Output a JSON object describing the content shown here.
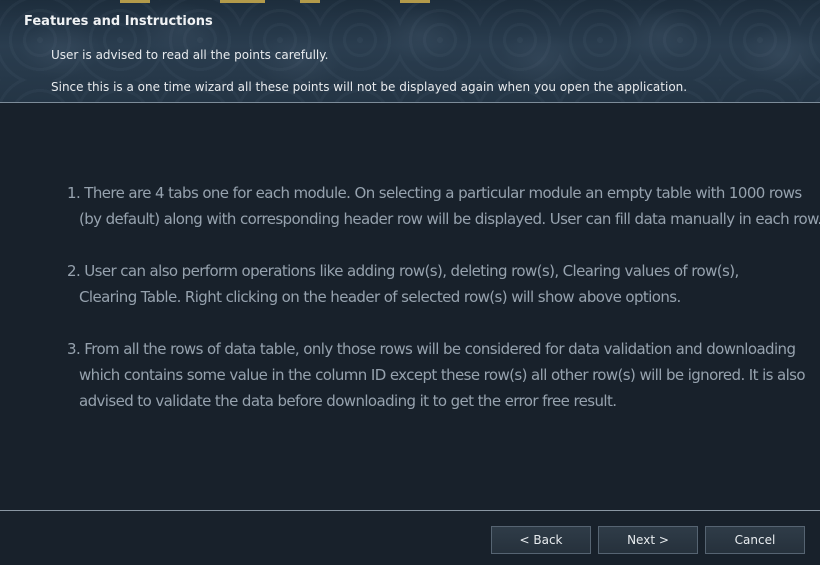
{
  "header": {
    "title": "Features and Instructions",
    "line1": "User is advised to read all the points carefully.",
    "line2": "Since this is a one time wizard all these points will not be displayed again when you open the application."
  },
  "instructions": [
    {
      "lines": [
        "1. There are 4 tabs one for each module. On selecting a particular module an empty table with 1000 rows",
        "(by default) along with corresponding header row will be displayed. User can fill data manually in each row."
      ]
    },
    {
      "lines": [
        "2. User can also perform operations like adding row(s), deleting row(s), Clearing values of row(s),",
        "Clearing Table. Right clicking on the header of selected row(s) will show above options."
      ]
    },
    {
      "lines": [
        "3. From all the rows of data table, only those rows will be considered for data validation and downloading",
        "which contains some value in the column ID except these row(s) all other row(s) will be ignored. It is also",
        "advised to validate the data before downloading it to get the error free result."
      ]
    }
  ],
  "buttons": {
    "back": "< Back",
    "next": "Next >",
    "cancel": "Cancel"
  },
  "colors": {
    "background": "#18212b",
    "text_muted": "#96a2ae",
    "accent": "#b39a4a"
  }
}
